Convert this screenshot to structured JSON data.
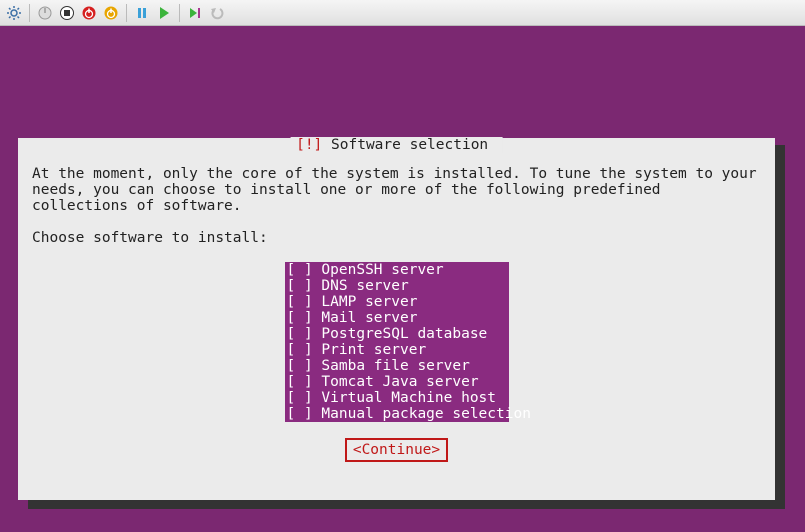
{
  "toolbar": {
    "icons": [
      "settings",
      "power-gray",
      "stop",
      "power-red",
      "power-yellow",
      "pause",
      "play",
      "play-ext",
      "undo"
    ]
  },
  "dialog": {
    "title_prefix": "[!]",
    "title": " Software selection ",
    "intro": "At the moment, only the core of the system is installed. To tune the system to your needs, you can choose to install one or more of the following predefined collections of software.",
    "prompt": "Choose software to install:",
    "options": [
      {
        "checked": false,
        "label": "OpenSSH server"
      },
      {
        "checked": false,
        "label": "DNS server"
      },
      {
        "checked": false,
        "label": "LAMP server"
      },
      {
        "checked": false,
        "label": "Mail server"
      },
      {
        "checked": false,
        "label": "PostgreSQL database"
      },
      {
        "checked": false,
        "label": "Print server"
      },
      {
        "checked": false,
        "label": "Samba file server"
      },
      {
        "checked": false,
        "label": "Tomcat Java server"
      },
      {
        "checked": false,
        "label": "Virtual Machine host"
      },
      {
        "checked": false,
        "label": "Manual package selection"
      }
    ],
    "continue_label": "<Continue>"
  }
}
